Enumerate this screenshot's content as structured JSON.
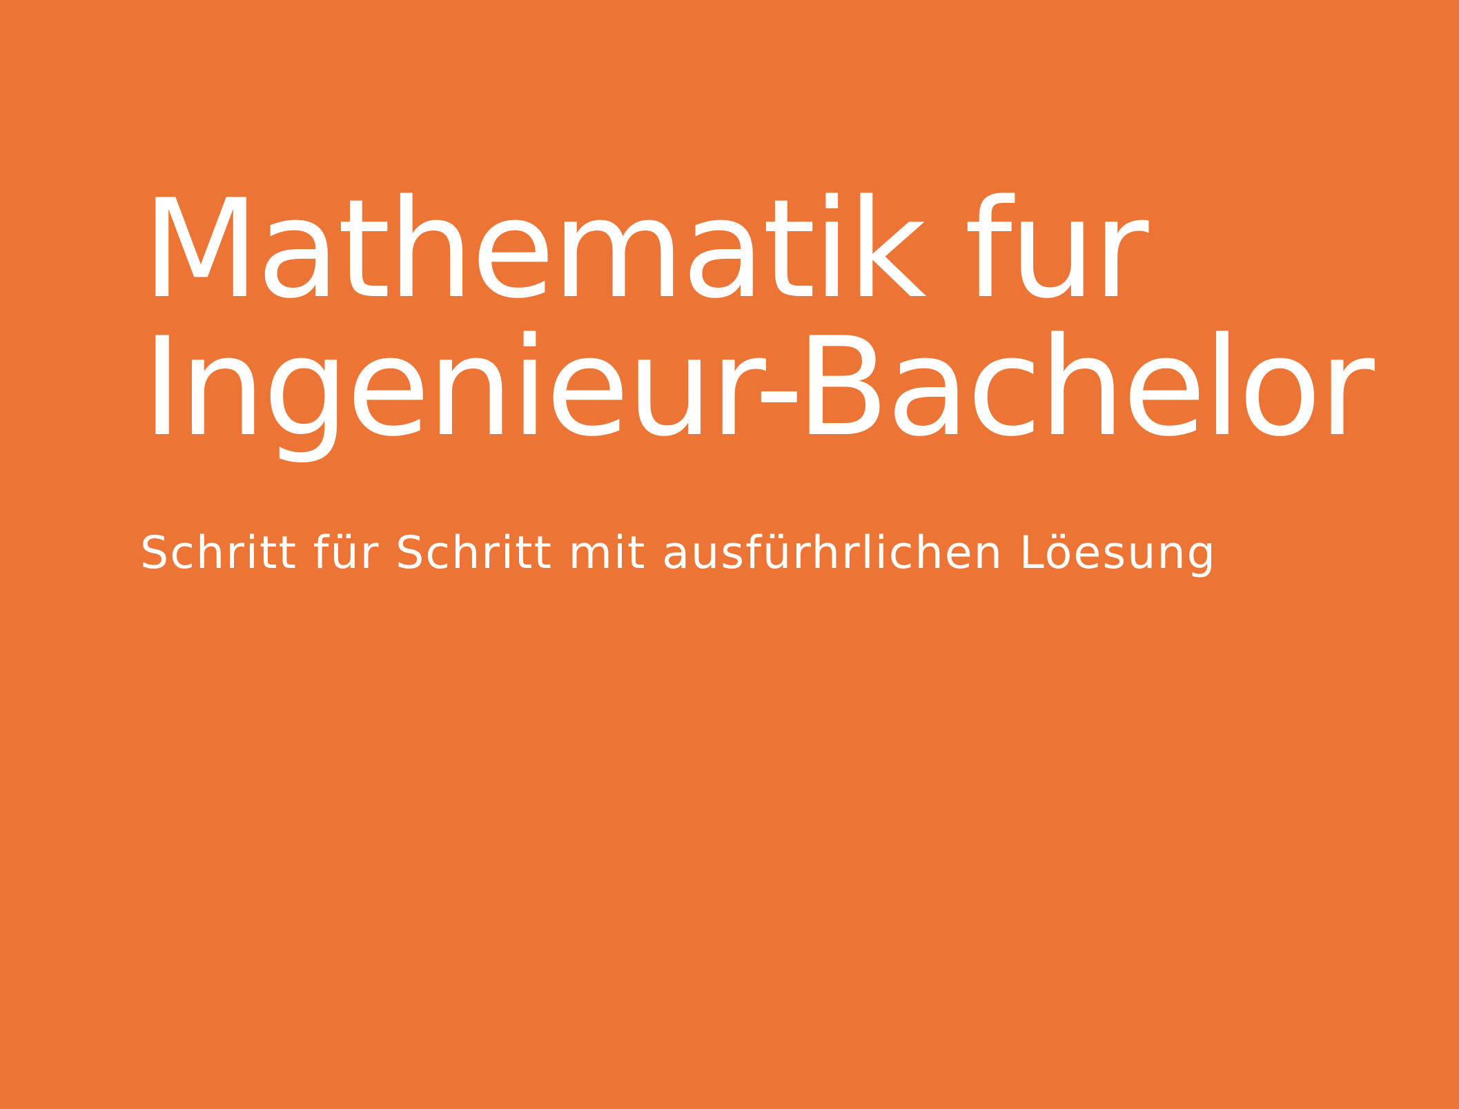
{
  "cover": {
    "title_line1": "Mathematik fur",
    "title_line2": "Ingenieur-Bachelor",
    "subtitle": "Schritt für Schritt mit ausfürhrlichen Löesung",
    "colors": {
      "background": "#ec7434",
      "text": "#ffffff"
    }
  }
}
